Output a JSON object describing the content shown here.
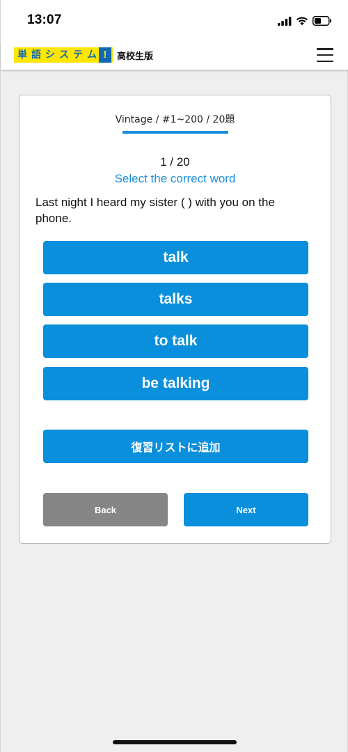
{
  "status_bar": {
    "time": "13:07",
    "icons": [
      "cellular-signal-icon",
      "wifi-icon",
      "battery-icon"
    ]
  },
  "header": {
    "logo_chars": [
      "単",
      "語",
      "シ",
      "ス",
      "テ",
      "ム"
    ],
    "logo_bang": "!",
    "logo_subtitle": "高校生版",
    "menu_icon": "hamburger-menu-icon",
    "logo_colors": {
      "background": "#ffe600",
      "text": "#1268b3"
    }
  },
  "quiz": {
    "deck_label": "Vintage / #1~200 / 20題",
    "progress": "1 / 20",
    "instruction": "Select the correct word",
    "question": "Last night I heard my sister ( ) with you on the phone.",
    "choices": [
      "talk",
      "talks",
      "to talk",
      "be talking"
    ],
    "review_button": "復習リストに追加",
    "back_button": "Back",
    "next_button": "Next"
  },
  "colors": {
    "accent": "#0a8fdc",
    "secondary_button": "#868686",
    "page_background": "#efefef"
  }
}
